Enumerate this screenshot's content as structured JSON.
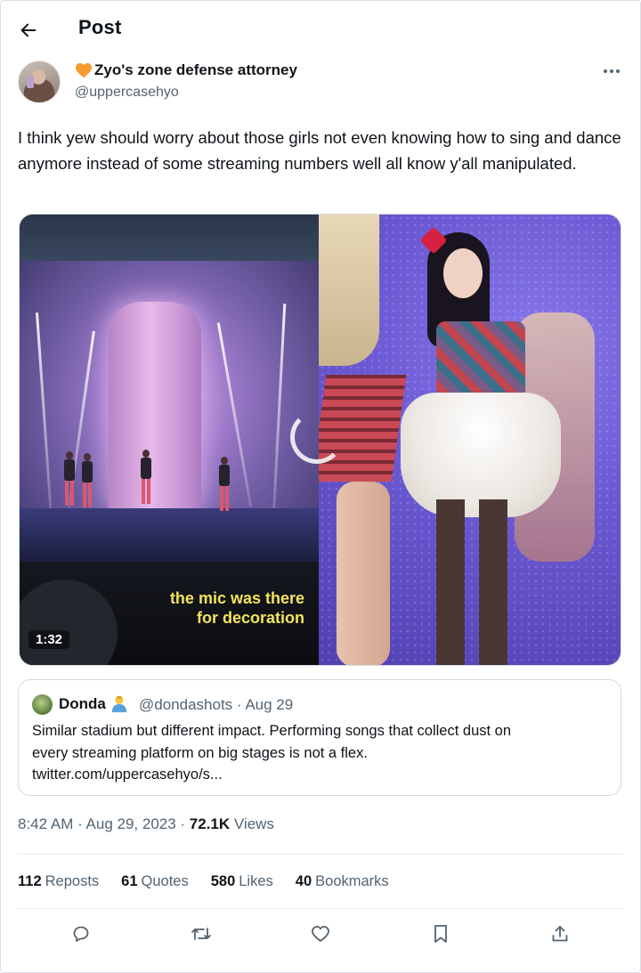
{
  "header": {
    "title": "Post"
  },
  "author": {
    "display_name": "Zyo's zone defense attorney",
    "handle": "@uppercasehyo"
  },
  "post": {
    "text": "I think yew should worry about those girls not even knowing how to sing and dance anymore instead of some streaming numbers well all know y'all manipulated.",
    "video": {
      "caption_line1": "the mic was there",
      "caption_line2": "for decoration",
      "duration": "1:32"
    }
  },
  "quote": {
    "name": "Donda",
    "handle_date": "@dondashots · Aug 29",
    "text_line1": "Similar stadium but different impact. Performing songs that collect dust on",
    "text_line2": "every streaming platform on big stages is not a flex.",
    "text_line3": "twitter.com/uppercasehyo/s..."
  },
  "meta": {
    "timestamp": "8:42 AM · Aug 29, 2023 · ",
    "views_count": "72.1K",
    "views_label": " Views"
  },
  "stats": {
    "reposts_count": "112",
    "reposts_label": "Reposts",
    "quotes_count": "61",
    "quotes_label": "Quotes",
    "likes_count": "580",
    "likes_label": "Likes",
    "bookmarks_count": "40",
    "bookmarks_label": "Bookmarks"
  },
  "icons": {
    "back": "arrow-left-icon",
    "more": "more-horizontal-icon",
    "reply": "reply-icon",
    "repost": "repost-icon",
    "like": "heart-icon",
    "bookmark": "bookmark-icon",
    "share": "share-icon"
  },
  "colors": {
    "text_primary": "#0f1419",
    "text_secondary": "#536471",
    "border": "#cfd9de",
    "caption": "#f3e35a",
    "heart_emoji": "#f59a2e"
  }
}
